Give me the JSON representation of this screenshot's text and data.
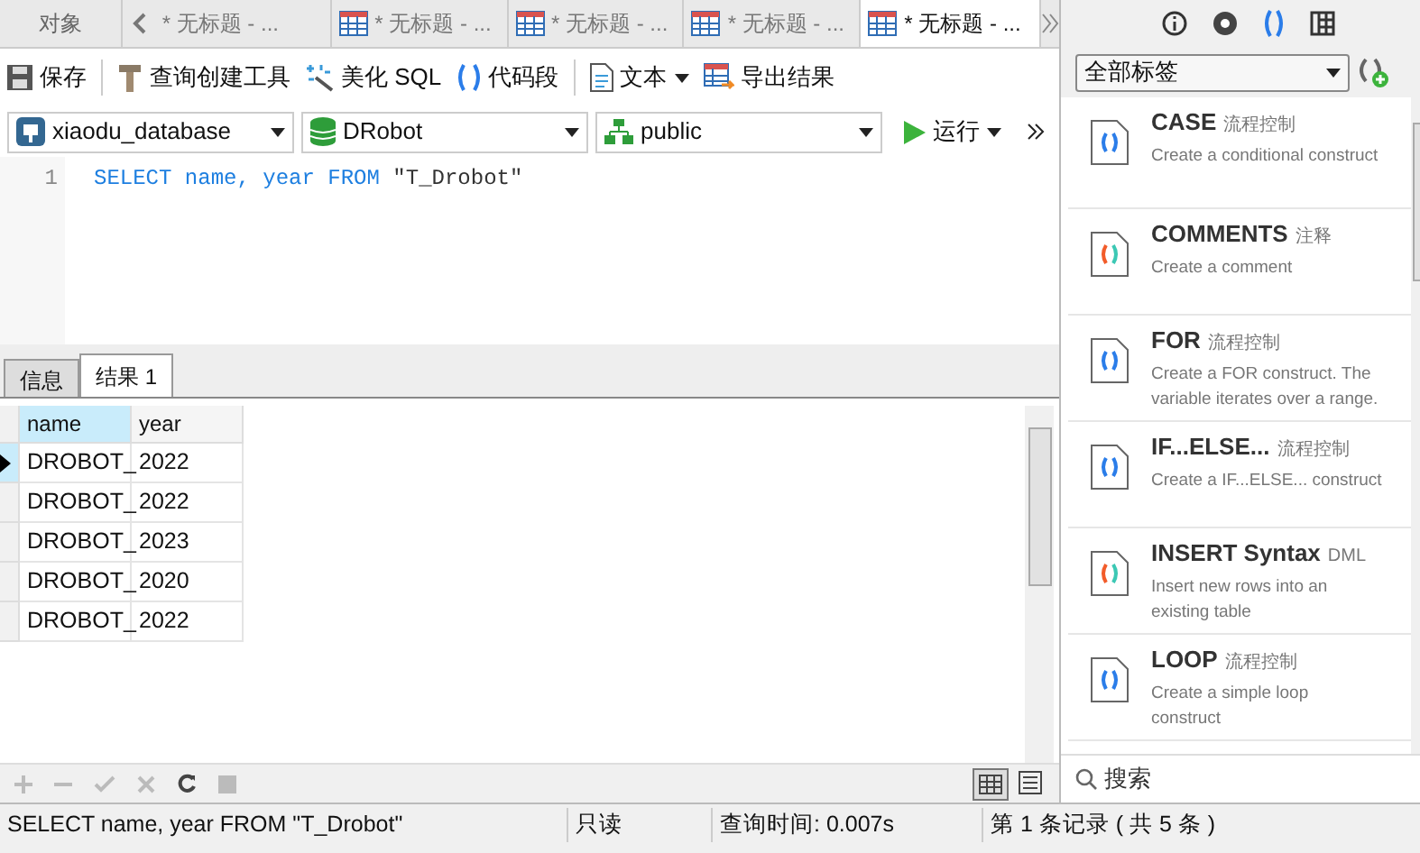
{
  "doc_tabs": {
    "objects_label": "对象",
    "tabs": [
      {
        "label": "* 无标题 - ...",
        "selected": false,
        "icon": false
      },
      {
        "label": "* 无标题 - ...",
        "selected": false,
        "icon": true
      },
      {
        "label": "* 无标题 - ...",
        "selected": false,
        "icon": true
      },
      {
        "label": "* 无标题 - ...",
        "selected": false,
        "icon": true
      },
      {
        "label": "* 无标题 - ...",
        "selected": true,
        "icon": true
      }
    ]
  },
  "toolbar": [
    {
      "kind": "save",
      "label": "保存"
    },
    {
      "kind": "builder",
      "label": "查询创建工具"
    },
    {
      "kind": "beautify",
      "label": "美化 SQL"
    },
    {
      "kind": "snippet",
      "label": "代码段"
    },
    {
      "kind": "text",
      "label": "文本",
      "dropdown": true
    },
    {
      "kind": "export",
      "label": "导出结果"
    }
  ],
  "selectors": [
    {
      "kind": "connection",
      "value": "xiaodu_database"
    },
    {
      "kind": "database",
      "value": "DRobot"
    },
    {
      "kind": "schema",
      "value": "public"
    }
  ],
  "run_label": "运行",
  "editor": {
    "lines": [
      {
        "number": "1",
        "keywords": [
          "SELECT",
          "name,",
          "year",
          "FROM"
        ],
        "string": "\"T_Drobot\""
      }
    ]
  },
  "result_tabs": [
    {
      "label": "信息",
      "selected": false
    },
    {
      "label": "结果 1",
      "selected": true
    }
  ],
  "table": {
    "columns": [
      {
        "label": "name",
        "selected": true
      },
      {
        "label": "year",
        "selected": false
      }
    ],
    "rows": [
      {
        "cells": [
          "DROBOT_",
          "2022"
        ],
        "selected": true
      },
      {
        "cells": [
          "DROBOT_",
          "2022"
        ],
        "selected": false
      },
      {
        "cells": [
          "DROBOT_",
          "2023"
        ],
        "selected": false
      },
      {
        "cells": [
          "DROBOT_",
          "2020"
        ],
        "selected": false
      },
      {
        "cells": [
          "DROBOT_",
          "2022"
        ],
        "selected": false
      }
    ]
  },
  "status_bar": {
    "query": "SELECT name, year FROM \"T_Drobot\"",
    "mode": "只读",
    "time": "查询时间: 0.007s",
    "record": "第 1 条记录 ( 共 5 条 )"
  },
  "side": {
    "filter": "全部标签",
    "snippets": [
      {
        "title": "CASE",
        "tag": "流程控制",
        "desc": "Create a conditional construct",
        "kind": "plain"
      },
      {
        "title": "COMMENTS",
        "tag": "注释",
        "desc": "Create a comment",
        "kind": "color"
      },
      {
        "title": "FOR",
        "tag": "流程控制",
        "desc": "Create a FOR construct. The variable iterates over a range.",
        "kind": "plain"
      },
      {
        "title": "IF...ELSE...",
        "tag": "流程控制",
        "desc": "Create a IF...ELSE... construct",
        "kind": "plain"
      },
      {
        "title": "INSERT Syntax",
        "tag": "DML",
        "desc": "Insert new rows into an existing table",
        "kind": "color"
      },
      {
        "title": "LOOP",
        "tag": "流程控制",
        "desc": "Create a simple loop construct",
        "kind": "plain"
      }
    ],
    "search_placeholder": "搜索"
  }
}
